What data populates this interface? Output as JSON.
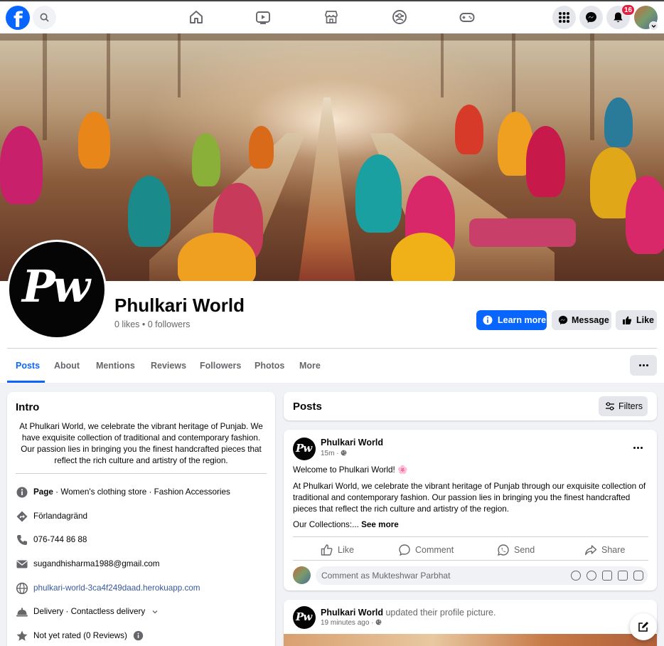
{
  "topbar": {
    "logo_letter": "f",
    "nav_icons": [
      "home-icon",
      "video-icon",
      "marketplace-icon",
      "groups-icon",
      "gaming-icon"
    ],
    "right_icons": [
      "menu-grid-icon",
      "messenger-icon",
      "bell-icon"
    ],
    "notification_count": "16"
  },
  "profile": {
    "logo_text": "Pw",
    "name": "Phulkari World",
    "stats": "0 likes • 0 followers",
    "buttons": {
      "learn_more": "Learn more",
      "message": "Message",
      "like": "Like"
    }
  },
  "tabs": [
    {
      "label": "Posts",
      "active": true
    },
    {
      "label": "About"
    },
    {
      "label": "Mentions"
    },
    {
      "label": "Reviews"
    },
    {
      "label": "Followers"
    },
    {
      "label": "Photos"
    },
    {
      "label": "More"
    }
  ],
  "intro": {
    "title": "Intro",
    "bio": "At Phulkari World, we celebrate the vibrant heritage of Punjab. We have exquisite collection of traditional and contemporary fashion. Our passion lies in bringing you the finest handcrafted pieces that reflect the rich culture and artistry of the region.",
    "category_prefix": "Page",
    "category": " · Women's clothing store · Fashion Accessories",
    "address": "Förlandagränd",
    "phone": "076-744 86 88",
    "email": "sugandhisharma1988@gmail.com",
    "website": "phulkari-world-3ca4f249daad.herokuapp.com",
    "delivery": "Delivery · Contactless delivery",
    "rating": "Not yet rated (0 Reviews)"
  },
  "posts_header": {
    "title": "Posts",
    "filters_label": "Filters"
  },
  "post": {
    "author": "Phulkari World",
    "time": "15m ·",
    "greeting": "Welcome to Phulkari World! 🌸",
    "body": "At Phulkari World, we celebrate the vibrant heritage of Punjab through our exquisite collection of traditional and contemporary fashion. Our passion lies in bringing you the finest handcrafted pieces that reflect the rich culture and artistry of the region.",
    "collections": "Our Collections:...",
    "see_more": "See more",
    "actions": {
      "like": "Like",
      "comment": "Comment",
      "send": "Send",
      "share": "Share"
    },
    "comment_placeholder": "Comment as Mukteshwar Parbhat"
  },
  "post2": {
    "author": "Phulkari World",
    "action_text": " updated their profile picture.",
    "time": "19 minutes ago ·"
  },
  "colors": {
    "accent": "#0866ff",
    "page_bg": "#f0f2f5",
    "badge": "#e41e3f"
  }
}
